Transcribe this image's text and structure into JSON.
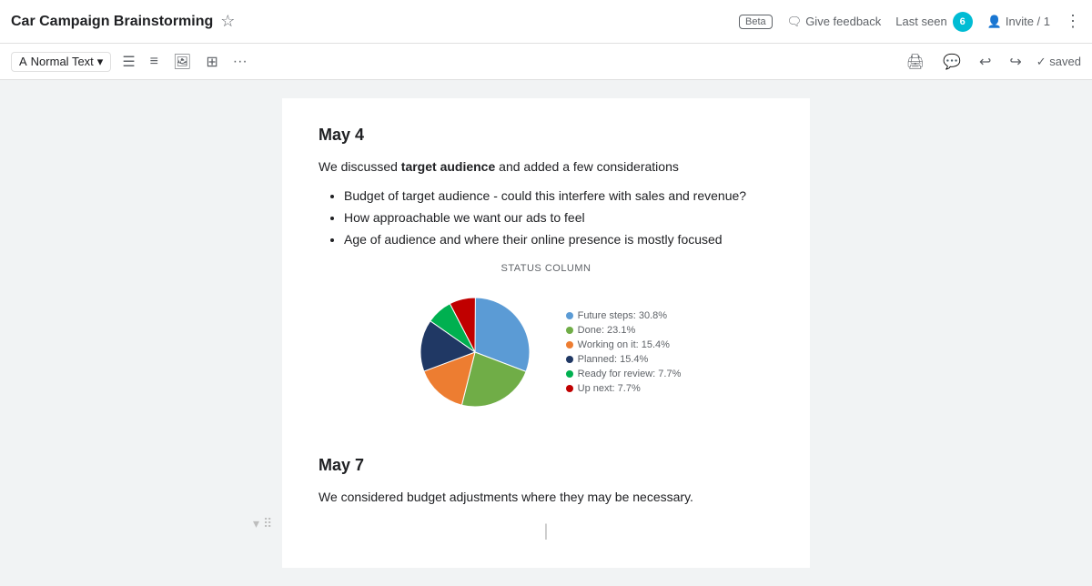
{
  "app": {
    "title": "Car Campaign Brainstorming",
    "beta_label": "Beta",
    "feedback_label": "Give feedback",
    "last_seen_label": "Last seen",
    "last_seen_count": "6",
    "invite_label": "Invite / 1",
    "saved_label": "✓ saved"
  },
  "toolbar": {
    "style_label": "Normal Text",
    "print_icon": "🖨",
    "comment_icon": "💬",
    "undo_icon": "↩",
    "redo_icon": "↪"
  },
  "content": {
    "section1": {
      "date": "May 4",
      "intro_pre": "We discussed ",
      "bold_word": "target audience",
      "intro_post": " and added a few considerations",
      "bullets": [
        "Budget of target audience - could this interfere with sales and revenue?",
        "How approachable we want our ads to feel",
        "Age of audience and where their online presence is mostly focused"
      ]
    },
    "chart": {
      "title": "STATUS COLUMN",
      "legend": [
        {
          "label": "Future steps: 30.8%",
          "color": "#5b9bd5"
        },
        {
          "label": "Done: 23.1%",
          "color": "#70ad47"
        },
        {
          "label": "Working on it: 15.4%",
          "color": "#ed7d31"
        },
        {
          "label": "Planned: 15.4%",
          "color": "#203864"
        },
        {
          "label": "Ready for review: 7.7%",
          "color": "#00b050"
        },
        {
          "label": "Up next: 7.7%",
          "color": "#c00000"
        }
      ],
      "slices": [
        {
          "color": "#5b9bd5",
          "pct": 30.8
        },
        {
          "color": "#70ad47",
          "pct": 23.1
        },
        {
          "color": "#ed7d31",
          "pct": 15.4
        },
        {
          "color": "#203864",
          "pct": 15.4
        },
        {
          "color": "#00b050",
          "pct": 7.7
        },
        {
          "color": "#c00000",
          "pct": 7.7
        }
      ]
    },
    "section2": {
      "date": "May 7",
      "text": "We considered budget adjustments where they may be necessary."
    }
  }
}
